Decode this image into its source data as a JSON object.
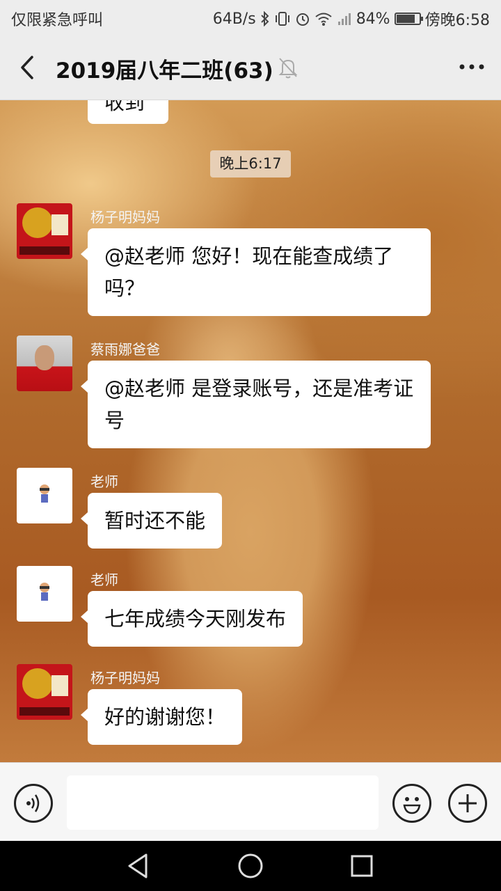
{
  "status_bar": {
    "carrier": "仅限紧急呼叫",
    "speed": "64B/s",
    "battery": "84%",
    "battery_level": 0.84,
    "time": "傍晚6:58"
  },
  "header": {
    "title": "2019届八年二班(63)"
  },
  "chat": {
    "partial_message": "收到",
    "timestamp": "晚上6:17",
    "messages": [
      {
        "sender": "杨子明妈妈",
        "avatar": "fu-logo-avatar",
        "text": "@赵老师  您好！现在能查成绩了吗？"
      },
      {
        "sender": "蔡雨娜爸爸",
        "avatar": "man-photo-avatar",
        "text": "@赵老师  是登录账号，还是准考证号"
      },
      {
        "sender": "老师",
        "avatar": "cartoon-avatar",
        "text": "暂时还不能"
      },
      {
        "sender": "老师",
        "avatar": "cartoon-avatar",
        "text": "七年成绩今天刚发布"
      },
      {
        "sender": "杨子明妈妈",
        "avatar": "fu-logo-avatar",
        "text": "好的谢谢您！"
      }
    ]
  },
  "input_bar": {
    "value": "",
    "icons": [
      "voice-icon",
      "emoji-icon",
      "plus-icon"
    ]
  },
  "nav_bar": {
    "icons": [
      "back-triangle-icon",
      "home-circle-icon",
      "recents-square-icon"
    ]
  }
}
